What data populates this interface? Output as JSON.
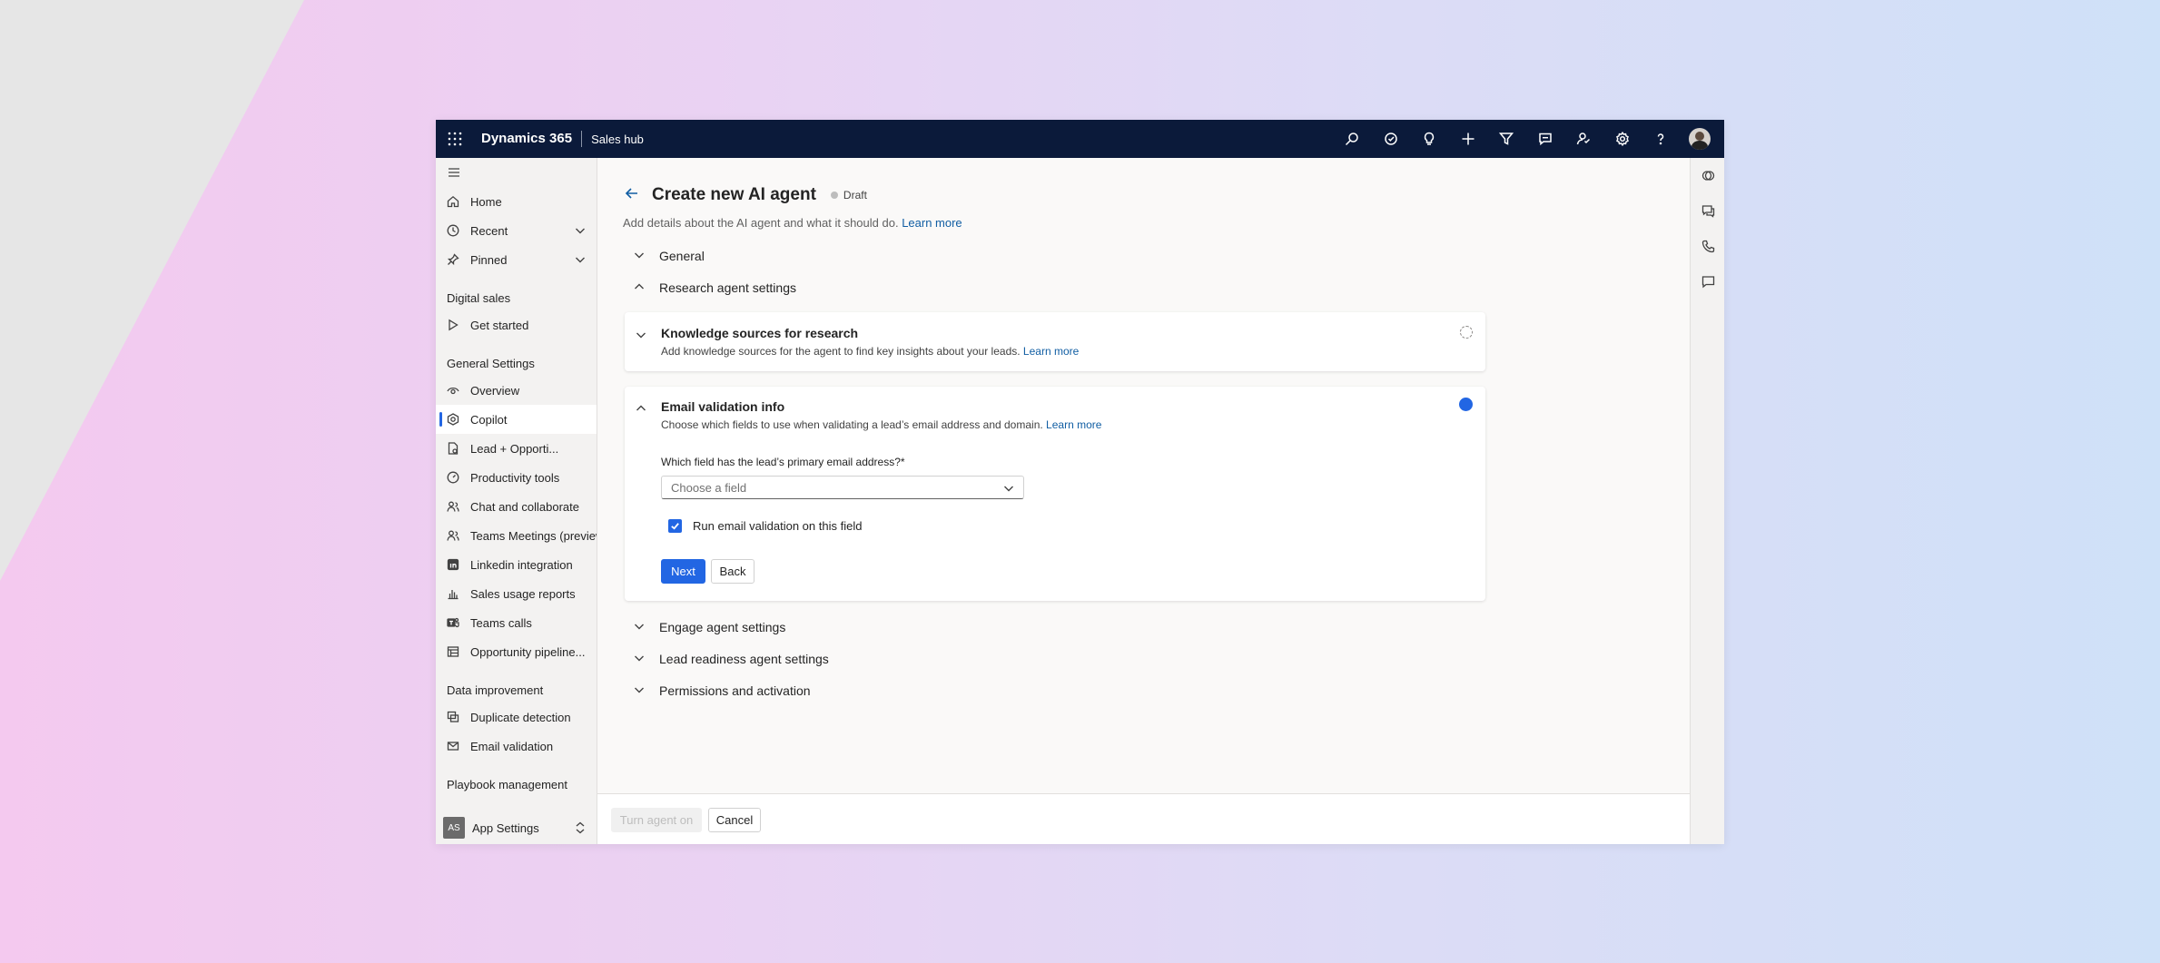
{
  "topbar": {
    "brand": "Dynamics 365",
    "hub": "Sales hub",
    "icons": [
      "search-icon",
      "task-icon",
      "lightbulb-icon",
      "add-icon",
      "filter-icon",
      "chat-icon",
      "assist-icon",
      "settings-icon",
      "help-icon"
    ]
  },
  "sidebar": {
    "top_items": [
      {
        "label": "Home",
        "icon": "home-icon"
      },
      {
        "label": "Recent",
        "icon": "clock-icon"
      },
      {
        "label": "Pinned",
        "icon": "pin-icon"
      }
    ],
    "groups": [
      {
        "title": "Digital sales",
        "items": [
          {
            "label": "Get started",
            "icon": "play-icon"
          }
        ]
      },
      {
        "title": "General Settings",
        "items": [
          {
            "label": "Overview",
            "icon": "eye-icon"
          },
          {
            "label": "Copilot",
            "icon": "copilot-icon"
          },
          {
            "label": "Lead + Opporti...",
            "icon": "document-icon"
          },
          {
            "label": "Productivity tools",
            "icon": "gauge-icon"
          },
          {
            "label": "Chat and collaborate",
            "icon": "people-icon"
          },
          {
            "label": "Teams Meetings (preview",
            "icon": "people-icon"
          },
          {
            "label": "Linkedin integration",
            "icon": "linkedin-icon"
          },
          {
            "label": "Sales usage reports",
            "icon": "chart-icon"
          },
          {
            "label": "Teams calls",
            "icon": "teams-icon"
          },
          {
            "label": "Opportunity pipeline...",
            "icon": "table-icon"
          }
        ]
      },
      {
        "title": "Data improvement",
        "items": [
          {
            "label": "Duplicate detection",
            "icon": "duplicate-icon"
          },
          {
            "label": "Email validation",
            "icon": "mail-icon"
          }
        ]
      },
      {
        "title": "Playbook management",
        "items": []
      }
    ],
    "footer": {
      "badge": "AS",
      "label": "App Settings"
    }
  },
  "page": {
    "title": "Create new AI agent",
    "status": "Draft",
    "subtitle": "Add details about the AI agent and what it should do.",
    "subtitle_link": "Learn more"
  },
  "sections": {
    "general": "General",
    "research": "Research agent settings",
    "engage": "Engage agent settings",
    "lead_readiness": "Lead readiness agent settings",
    "permissions": "Permissions and activation"
  },
  "knowledge_card": {
    "title": "Knowledge sources for research",
    "desc": "Add knowledge sources for the agent to find key insights about your leads.",
    "link": "Learn more"
  },
  "email_card": {
    "title": "Email validation info",
    "desc": "Choose which fields to use when validating a lead’s email address and domain.",
    "link": "Learn more",
    "field_label": "Which field has the lead’s primary email address?*",
    "select_placeholder": "Choose a field",
    "checkbox_label": "Run email validation on this field",
    "checkbox_checked": true,
    "next": "Next",
    "back": "Back"
  },
  "footer": {
    "turn_on": "Turn agent on",
    "cancel": "Cancel"
  }
}
